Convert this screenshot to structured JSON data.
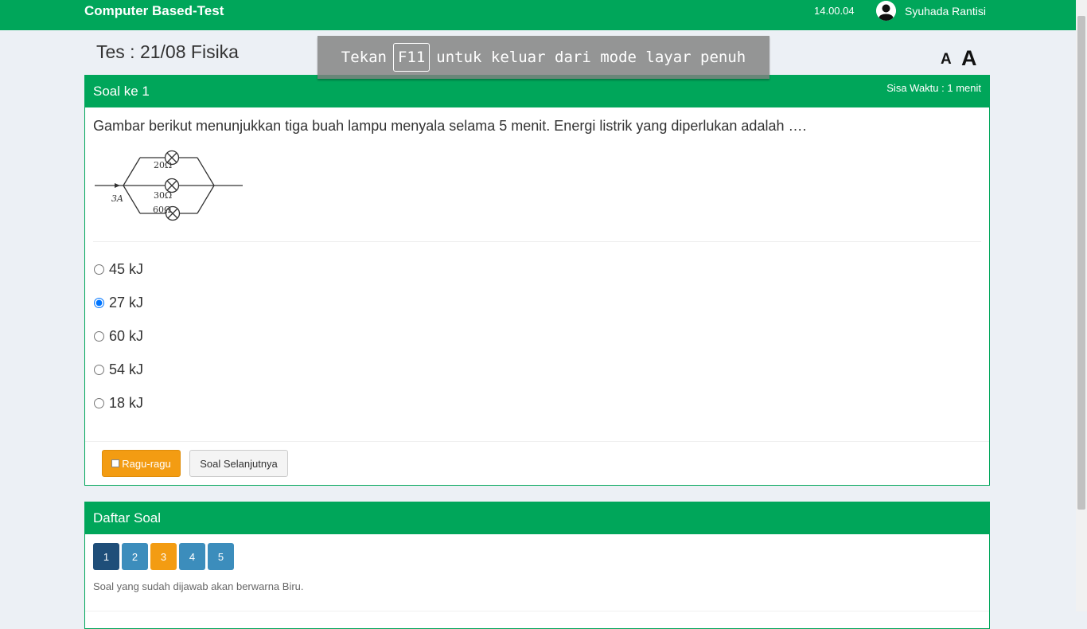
{
  "header": {
    "brand": "Computer Based-Test",
    "clock": "14.00.04",
    "user_name": "Syuhada Rantisi"
  },
  "test": {
    "title": "Tes : 21/08 Fisika",
    "font_small_label": "A",
    "font_large_label": "A"
  },
  "fullscreen_notice": {
    "before": "Tekan",
    "key": "F11",
    "after": "untuk keluar dari mode layar penuh"
  },
  "question_panel": {
    "title": "Soal ke 1",
    "time_left": "Sisa Waktu : 1 menit",
    "question": "Gambar berikut menunjukkan tiga buah lampu menyala selama 5 menit. Energi listrik yang diperlukan adalah ….",
    "figure": {
      "current_label": "3A",
      "r1": "20Ω",
      "r2": "30Ω",
      "r3": "60Ω"
    },
    "options": [
      {
        "label": "45 kJ",
        "selected": false
      },
      {
        "label": "27 kJ",
        "selected": true
      },
      {
        "label": "60 kJ",
        "selected": false
      },
      {
        "label": "54 kJ",
        "selected": false
      },
      {
        "label": "18 kJ",
        "selected": false
      }
    ],
    "doubt_button": "Ragu-ragu",
    "next_button": "Soal Selanjutnya"
  },
  "question_list": {
    "title": "Daftar Soal",
    "numbers": [
      {
        "label": "1",
        "color": "#1f4e79"
      },
      {
        "label": "2",
        "color": "#3c8dbc"
      },
      {
        "label": "3",
        "color": "#f39c12"
      },
      {
        "label": "4",
        "color": "#3c8dbc"
      },
      {
        "label": "5",
        "color": "#3c8dbc"
      }
    ],
    "note": "Soal yang sudah dijawab akan berwarna Biru."
  },
  "colors": {
    "header_green": "#00a65a",
    "warning_orange": "#f39c12",
    "answered_blue": "#3c8dbc",
    "current_dark_blue": "#1f4e79"
  }
}
